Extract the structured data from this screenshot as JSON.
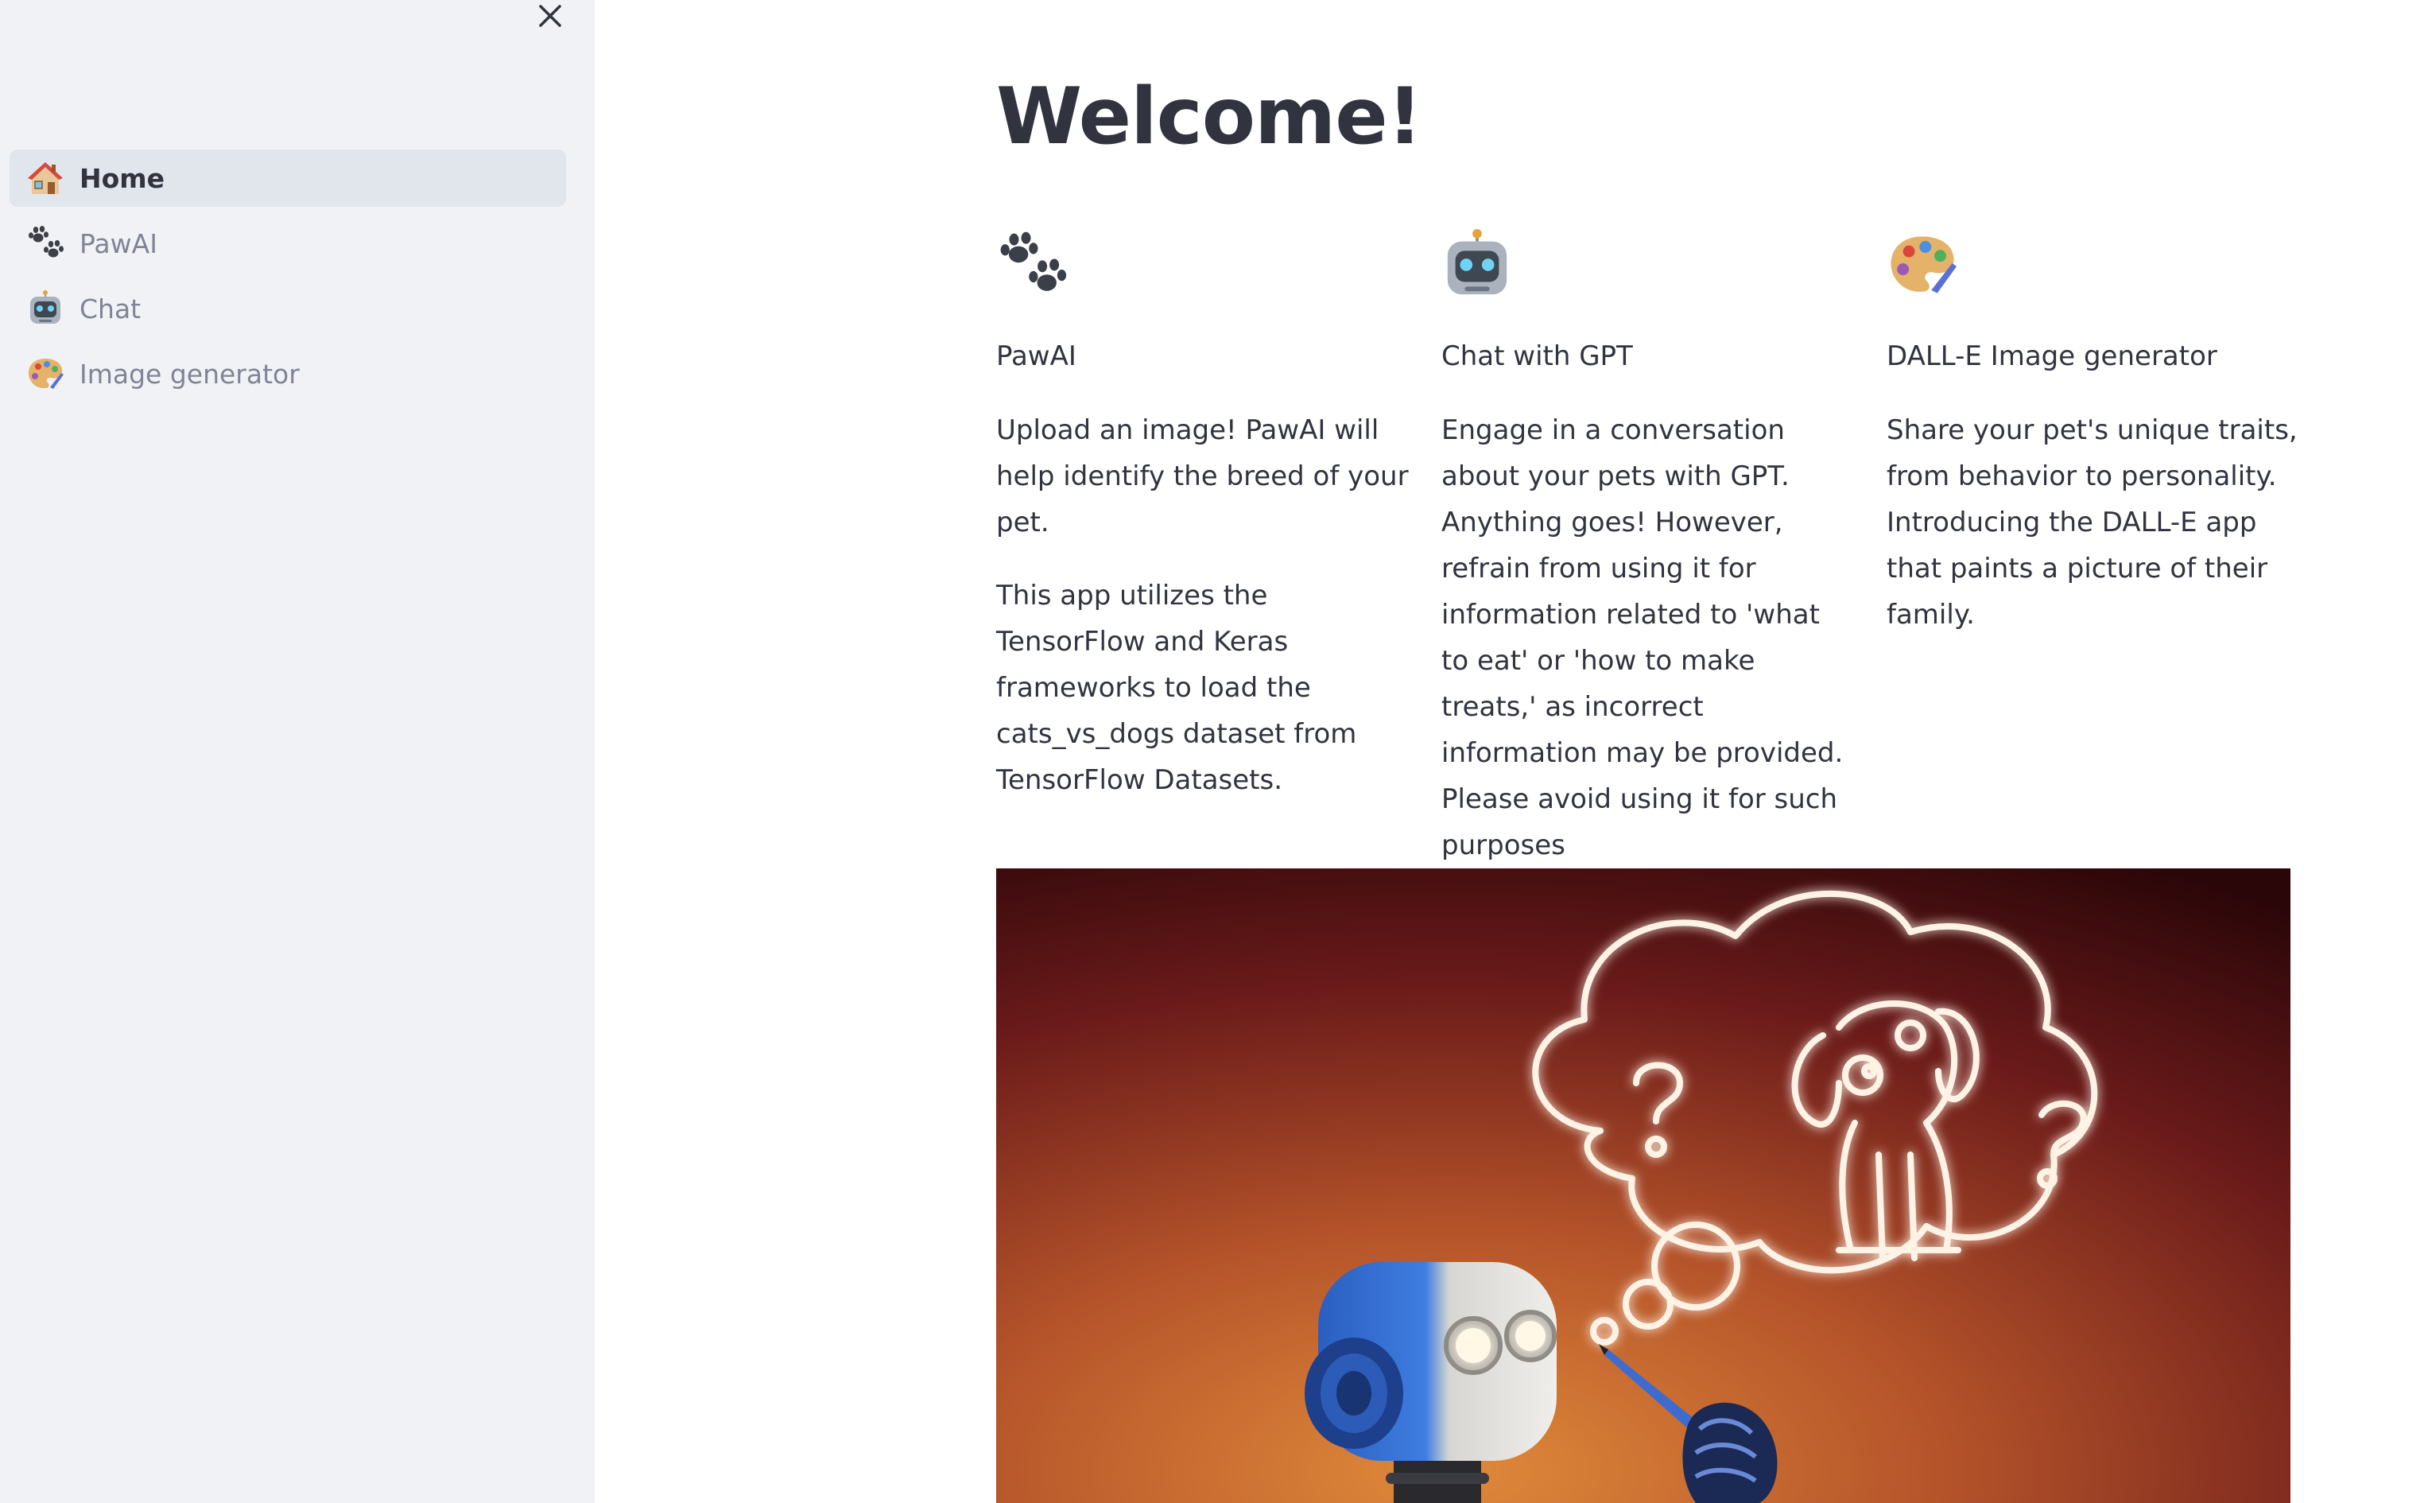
{
  "sidebar": {
    "close_icon": "close-icon",
    "items": [
      {
        "label": "Home",
        "icon": "house-icon",
        "active": true
      },
      {
        "label": "PawAI",
        "icon": "paw-prints-icon",
        "active": false
      },
      {
        "label": "Chat",
        "icon": "robot-icon",
        "active": false
      },
      {
        "label": "Image generator",
        "icon": "palette-icon",
        "active": false
      }
    ]
  },
  "main": {
    "title": "Welcome!",
    "columns": [
      {
        "icon": "paw-prints-icon",
        "heading": "PawAI",
        "paragraphs": [
          "Upload an image! PawAI will help identify the breed of your pet.",
          "This app utilizes the TensorFlow and Keras frameworks to load the cats_vs_dogs dataset from TensorFlow Datasets."
        ]
      },
      {
        "icon": "robot-icon",
        "heading": "Chat with GPT",
        "paragraphs": [
          "Engage in a conversation about your pets with GPT. Anything goes! However, refrain from using it for information related to 'what to eat' or 'how to make treats,' as incorrect information may be provided. Please avoid using it for such purposes"
        ]
      },
      {
        "icon": "palette-icon",
        "heading": "DALL-E Image generator",
        "paragraphs": [
          "Share your pet's unique traits, from behavior to personality. Introducing the DALL-E app that paints a picture of their family."
        ]
      }
    ],
    "hero_image": "robot-drawing-dog-thought-bubble"
  },
  "colors": {
    "sidebar_bg": "#f0f2f6",
    "active_item_bg": "#e1e5ec",
    "text_primary": "#31333f",
    "text_muted": "#808495"
  }
}
